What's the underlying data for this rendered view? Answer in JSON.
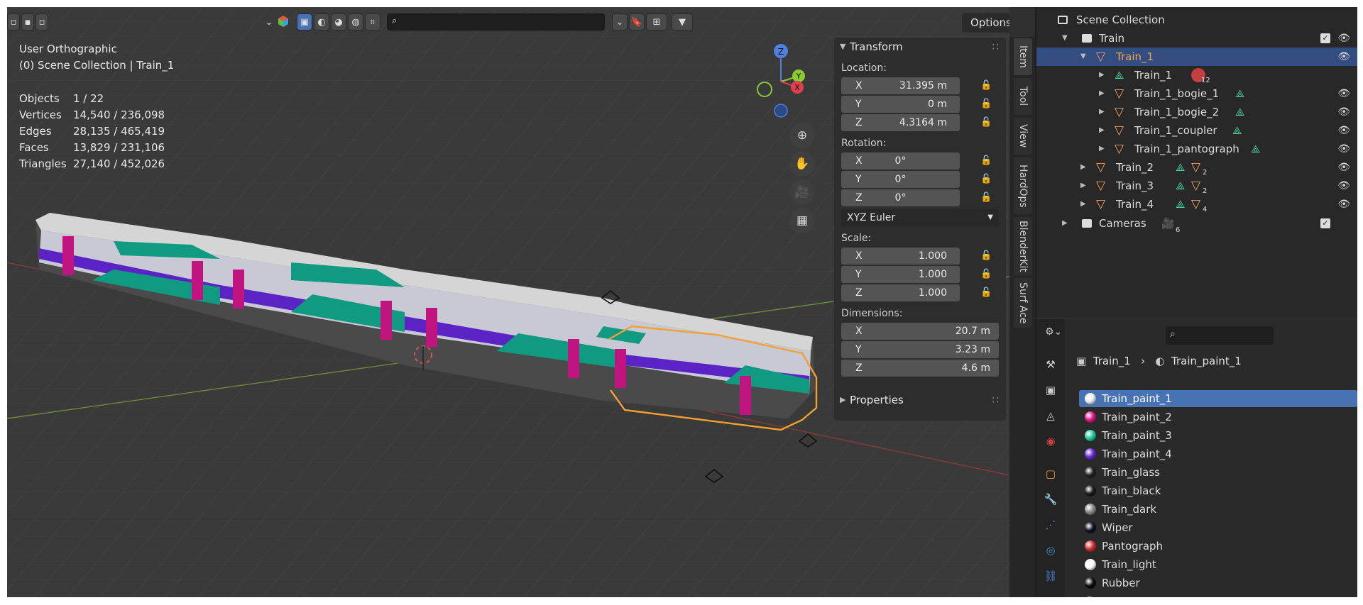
{
  "viewport": {
    "view_name": "User Orthographic",
    "context": "(0) Scene Collection | Train_1",
    "stats": [
      {
        "label": "Objects",
        "value": "1 / 22"
      },
      {
        "label": "Vertices",
        "value": "14,540 / 236,098"
      },
      {
        "label": "Edges",
        "value": "28,135 / 465,419"
      },
      {
        "label": "Faces",
        "value": "13,829 / 231,106"
      },
      {
        "label": "Triangles",
        "value": "27,140 / 452,026"
      }
    ],
    "options_label": "Options",
    "gizmo": {
      "z": "Z",
      "y": "Y",
      "x": "X"
    }
  },
  "npanel": {
    "transform_title": "Transform",
    "location_label": "Location:",
    "location": [
      {
        "axis": "X",
        "value": "31.395 m"
      },
      {
        "axis": "Y",
        "value": "0 m"
      },
      {
        "axis": "Z",
        "value": "4.3164 m"
      }
    ],
    "rotation_label": "Rotation:",
    "rotation": [
      {
        "axis": "X",
        "value": "0°"
      },
      {
        "axis": "Y",
        "value": "0°"
      },
      {
        "axis": "Z",
        "value": "0°"
      }
    ],
    "rotation_mode": "XYZ Euler",
    "scale_label": "Scale:",
    "scale": [
      {
        "axis": "X",
        "value": "1.000"
      },
      {
        "axis": "Y",
        "value": "1.000"
      },
      {
        "axis": "Z",
        "value": "1.000"
      }
    ],
    "dimensions_label": "Dimensions:",
    "dimensions": [
      {
        "axis": "X",
        "value": "20.7 m"
      },
      {
        "axis": "Y",
        "value": "3.23 m"
      },
      {
        "axis": "Z",
        "value": "4.6 m"
      }
    ],
    "properties_title": "Properties"
  },
  "side_tabs": [
    "Item",
    "Tool",
    "View",
    "HardOps",
    "BlenderKit",
    "Surf Ace"
  ],
  "outliner": {
    "root": "Scene Collection",
    "items": [
      {
        "label": "Train",
        "kind": "collection"
      },
      {
        "label": "Train_1",
        "kind": "object",
        "selected": true
      },
      {
        "label": "Train_1",
        "kind": "mesh",
        "badge": "12"
      },
      {
        "label": "Train_1_bogie_1",
        "kind": "object"
      },
      {
        "label": "Train_1_bogie_2",
        "kind": "object"
      },
      {
        "label": "Train_1_coupler",
        "kind": "object"
      },
      {
        "label": "Train_1_pantograph",
        "kind": "object"
      },
      {
        "label": "Train_2",
        "kind": "object",
        "badge": "2"
      },
      {
        "label": "Train_3",
        "kind": "object",
        "badge": "2"
      },
      {
        "label": "Train_4",
        "kind": "object",
        "badge": "4"
      },
      {
        "label": "Cameras",
        "kind": "collection",
        "badge": "6"
      }
    ]
  },
  "properties": {
    "breadcrumb_object": "Train_1",
    "breadcrumb_material": "Train_paint_1",
    "materials": [
      {
        "name": "Train_paint_1",
        "color": "#eeeeee"
      },
      {
        "name": "Train_paint_2",
        "color": "#e0158c"
      },
      {
        "name": "Train_paint_3",
        "color": "#1fc8a0"
      },
      {
        "name": "Train_paint_4",
        "color": "#6a2ad8"
      },
      {
        "name": "Train_glass",
        "color": "#222222"
      },
      {
        "name": "Train_black",
        "color": "#1a1a1a"
      },
      {
        "name": "Train_dark",
        "color": "#8a8a8a"
      },
      {
        "name": "Wiper",
        "color": "#111122"
      },
      {
        "name": "Pantograph",
        "color": "#d03030"
      },
      {
        "name": "Train_light",
        "color": "#ffffff"
      },
      {
        "name": "Rubber",
        "color": "#0c0c0c"
      },
      {
        "name": "Gangway",
        "color": "#333333"
      }
    ]
  }
}
